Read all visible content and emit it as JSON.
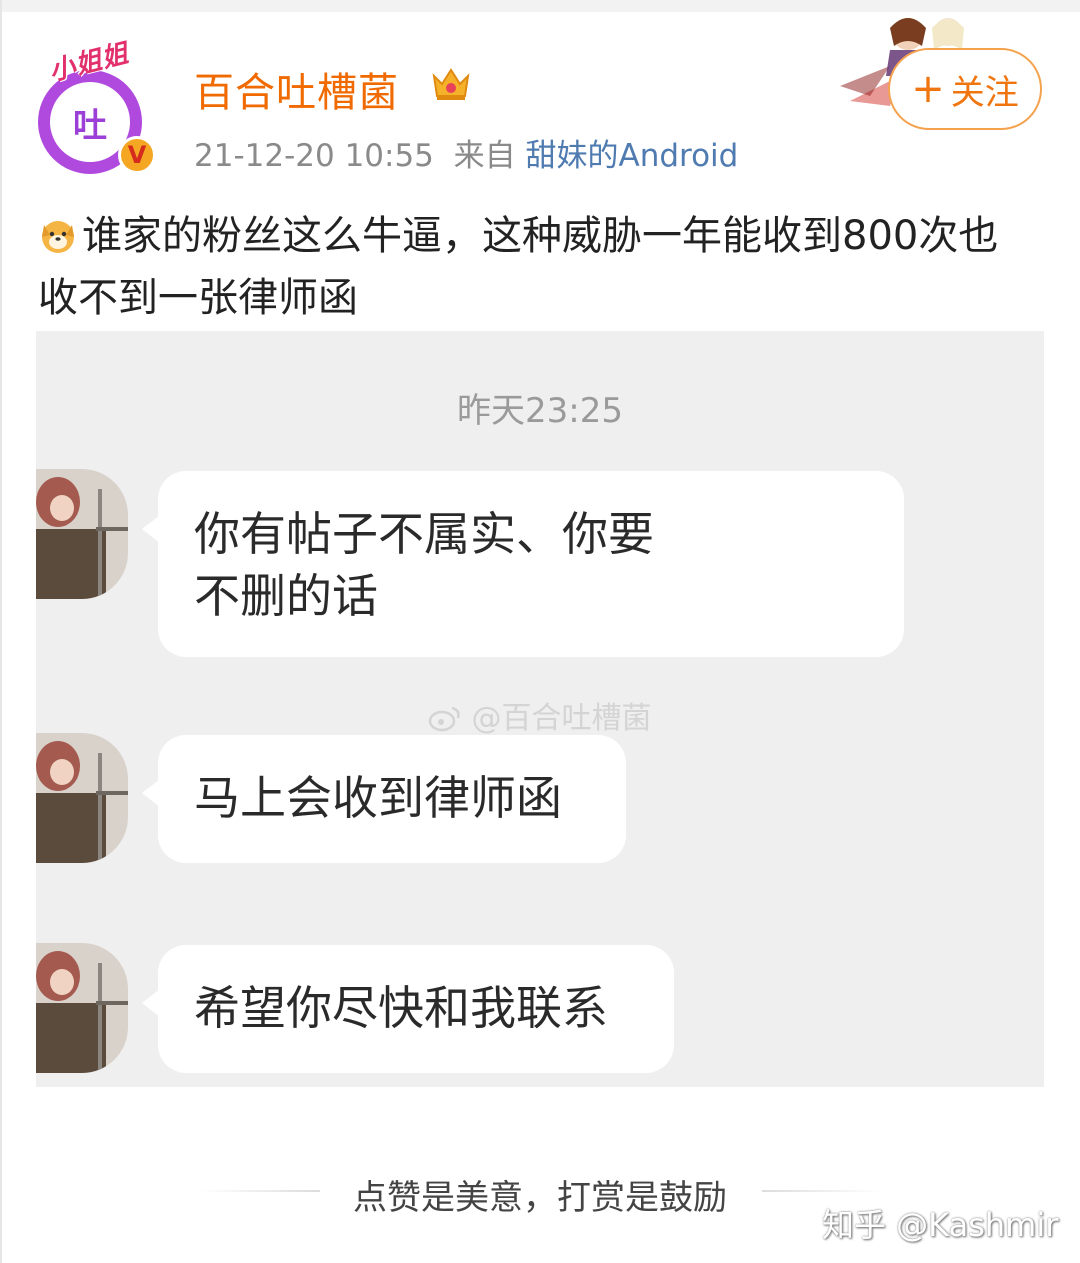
{
  "post": {
    "avatar_char": "吐",
    "avatar_tag": "小姐姐",
    "verified_mark": "V",
    "username": "百合吐槽菌",
    "timestamp": "21-12-20 10:55",
    "from_label": "来自",
    "source": "甜妹的Android",
    "follow_plus": "+",
    "follow_label": "关注",
    "text": "谁家的粉丝这么牛逼，这种威胁一年能收到800次也收不到一张律师函"
  },
  "screenshot": {
    "time": "昨天23:25",
    "watermark": "@百合吐槽菌",
    "messages": [
      {
        "line1": "你有帖子不属实、你要",
        "line2": "不删的话"
      },
      {
        "line1": "马上会收到律师函",
        "line2": ""
      },
      {
        "line1": "希望你尽快和我联系",
        "line2": ""
      }
    ]
  },
  "footer": {
    "text": "点赞是美意，打赏是鼓励",
    "zhihu_watermark": "知乎 @Kashmir"
  },
  "colors": {
    "username": "#f06a00",
    "source_link": "#4f7bb1",
    "follow_border": "#f5a24f",
    "avatar_ring": "#b04adf"
  },
  "icons": [
    "crown-icon",
    "verified-badge-icon",
    "dog-emoji-icon",
    "weibo-logo-icon"
  ]
}
